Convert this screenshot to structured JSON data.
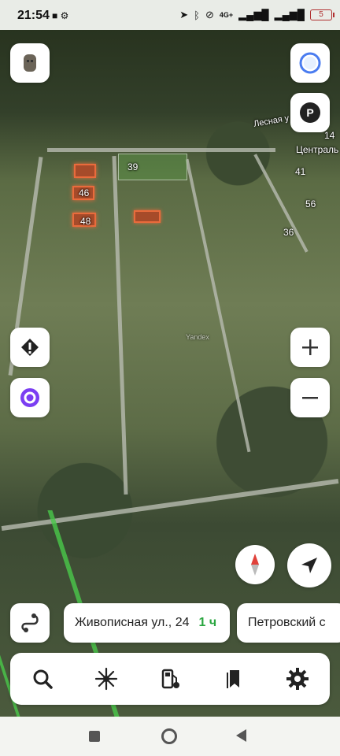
{
  "status_bar": {
    "time": "21:54",
    "network": "4G+",
    "battery": "5"
  },
  "map": {
    "labels": {
      "house_39": "39",
      "house_46": "46",
      "house_48": "48",
      "house_14": "14",
      "house_41": "41",
      "house_56": "56",
      "house_36": "36",
      "street_central": "Централь",
      "street_forest": "Лесная у"
    },
    "watermark": "Yandex"
  },
  "route_chips": [
    {
      "address": "Живописная ул., 24",
      "duration": "1 ч"
    },
    {
      "address": "Петровский с"
    }
  ],
  "colors": {
    "accent_blue": "#4a7cf0",
    "alice_purple": "#7b3ef2",
    "route_green": "#4ac94a",
    "duration_green": "#2aa640",
    "compass_red": "#e0413a"
  },
  "icons": {
    "profile": "profile-avatar-icon",
    "alice": "alice-icon",
    "parking": "parking-icon",
    "warning": "road-event-icon",
    "zoom_in": "plus-icon",
    "zoom_out": "minus-icon",
    "compass": "compass-icon",
    "my_location": "location-arrow-icon",
    "route": "route-icon",
    "search": "search-icon",
    "discover": "discover-icon",
    "gas": "gas-station-icon",
    "bookmarks": "bookmarks-icon",
    "settings": "gear-icon"
  }
}
